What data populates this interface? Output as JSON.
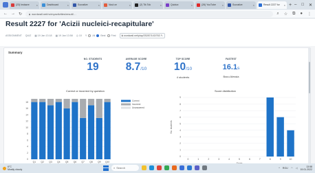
{
  "browser": {
    "tabs": [
      {
        "label": "(23) Instacre",
        "color": "#d83a3a"
      },
      {
        "label": "Dashboard",
        "color": "#3c8fd6"
      },
      {
        "label": "Socrative",
        "color": "#3357a8"
      },
      {
        "label": "Noul ce",
        "color": "#e35c3c"
      },
      {
        "label": "(2) Tik Tok",
        "color": "#222222"
      },
      {
        "label": "Quizizz",
        "color": "#7a3ec8"
      },
      {
        "label": "(26) YouTube",
        "color": "#e02828"
      },
      {
        "label": "Socrative",
        "color": "#3357a8"
      },
      {
        "label": "Result 2227 for",
        "color": "#2c6fd3",
        "active": true
      }
    ],
    "url": "wordwall.net/ro/myactivities/result/…"
  },
  "page": {
    "title": "Result 2227 for 'Acizii nucleici-recapitulare'",
    "meta": {
      "type": "ASSIGNMENT",
      "mode": "QUIZ",
      "start": "19 Jan 13:18",
      "end": "19 Jan 13:58",
      "count": "10",
      "filter_label": "Y",
      "filter_options": [
        "All",
        "Best",
        "First"
      ],
      "filter_selected": "Best",
      "link": "wordwall.net/play/25287/143/763"
    }
  },
  "summary": {
    "title": "Summary",
    "stats": [
      {
        "label": "NO. STUDENTS",
        "value": "19",
        "suffix": "",
        "sub": ""
      },
      {
        "label": "AVERAGE SCORE",
        "value": "8.7",
        "suffix": "/10",
        "sub": ""
      },
      {
        "label": "TOP SCORE",
        "value": "10",
        "suffix": "/10",
        "sub": "4 students"
      },
      {
        "label": "FASTEST",
        "value": "16.1",
        "suffix": "s",
        "sub": "Bacu Alessia"
      }
    ]
  },
  "chart_data": [
    {
      "type": "bar",
      "title": "Correct or incorrect by question",
      "stacked": true,
      "categories": [
        "Q1",
        "Q2",
        "Q3",
        "Q4",
        "Q5",
        "Q6",
        "Q7",
        "Q8",
        "Q9",
        "Q10"
      ],
      "series": [
        {
          "name": "Correct",
          "color": "#1e73c8",
          "values": [
            18,
            18,
            17,
            18,
            16,
            18,
            13,
            17,
            13,
            18
          ]
        },
        {
          "name": "Incorrect",
          "color": "#a9acb0",
          "values": [
            1,
            1,
            2,
            1,
            3,
            1,
            6,
            2,
            6,
            1
          ]
        },
        {
          "name": "Unanswered",
          "color": "#dfe1e3",
          "values": [
            0,
            0,
            0,
            0,
            0,
            0,
            0,
            0,
            0,
            0
          ]
        }
      ],
      "yticks": [
        "0",
        "2",
        "4",
        "6",
        "8",
        "10",
        "12",
        "14",
        "16",
        "18"
      ],
      "ylim": [
        0,
        19
      ],
      "grid": true,
      "legend": "right"
    },
    {
      "type": "bar",
      "title": "Score distribution",
      "categories": [
        "0",
        "1",
        "2",
        "3",
        "4",
        "5",
        "6",
        "7",
        "8",
        "9",
        "10"
      ],
      "values": [
        0,
        0,
        0,
        0,
        0,
        0,
        0,
        0,
        9,
        6,
        4
      ],
      "color": "#1e73c8",
      "ylabel": "No. students",
      "xlabel": "Score",
      "yticks": [
        "0",
        "1",
        "2",
        "3",
        "4",
        "5",
        "6",
        "7",
        "8",
        "9"
      ],
      "ylim": [
        0,
        9
      ],
      "grid": true
    }
  ],
  "taskbar": {
    "weather_temp": "6°C",
    "weather_desc": "Mostly cloudy",
    "search_placeholder": "Search",
    "apps": [
      {
        "name": "file-explorer",
        "color": "#f2c12e"
      },
      {
        "name": "edge",
        "color": "#1c8fd8"
      },
      {
        "name": "chrome",
        "color": "#e0453a"
      },
      {
        "name": "chrome-2",
        "color": "#34a853"
      },
      {
        "name": "firefox",
        "color": "#e86a1f"
      },
      {
        "name": "store",
        "color": "#3a6fd8"
      },
      {
        "name": "mail",
        "color": "#2b79d2"
      },
      {
        "name": "teams",
        "color": "#5b5fc7"
      },
      {
        "name": "settings",
        "color": "#707880"
      }
    ],
    "lang": "ROU",
    "time": "13:58",
    "date": "19.01.2022"
  }
}
